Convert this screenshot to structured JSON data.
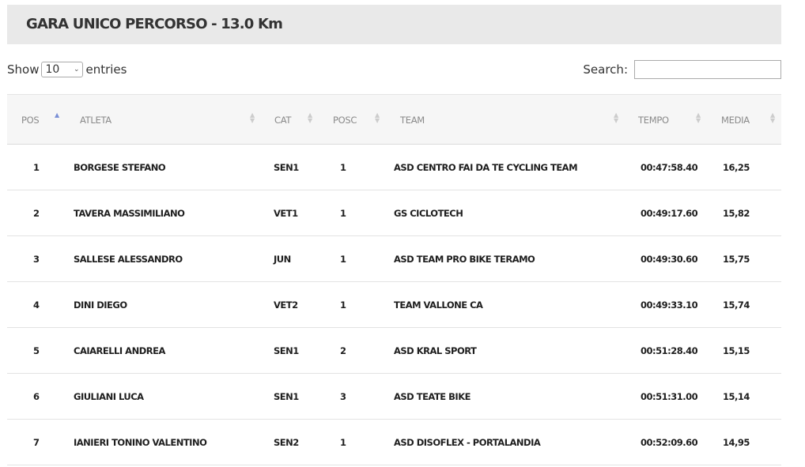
{
  "page": {
    "title": "GARA UNICO PERCORSO - 13.0 Km"
  },
  "controls": {
    "show_label": "Show",
    "entries_value": "10",
    "entries_label": "entries",
    "search_label": "Search:",
    "search_value": ""
  },
  "table": {
    "headers": [
      "POS",
      "ATLETA",
      "CAT",
      "POSC",
      "TEAM",
      "TEMPO",
      "MEDIA"
    ],
    "sorted_column": "POS",
    "sort_direction": "ascending",
    "rows": [
      [
        "1",
        "BORGESE STEFANO",
        "SEN1",
        "1",
        "ASD CENTRO FAI DA TE CYCLING TEAM",
        "00:47:58.40",
        "16,25"
      ],
      [
        "2",
        "TAVERA MASSIMILIANO",
        "VET1",
        "1",
        "GS CICLOTECH",
        "00:49:17.60",
        "15,82"
      ],
      [
        "3",
        "SALLESE ALESSANDRO",
        "JUN",
        "1",
        "ASD TEAM PRO BIKE TERAMO",
        "00:49:30.60",
        "15,75"
      ],
      [
        "4",
        "DINI DIEGO",
        "VET2",
        "1",
        "TEAM VALLONE CA",
        "00:49:33.10",
        "15,74"
      ],
      [
        "5",
        "CAIARELLI ANDREA",
        "SEN1",
        "2",
        "ASD KRAL SPORT",
        "00:51:28.40",
        "15,15"
      ],
      [
        "6",
        "GIULIANI LUCA",
        "SEN1",
        "3",
        "ASD TEATE BIKE",
        "00:51:31.00",
        "15,14"
      ],
      [
        "7",
        "IANIERI TONINO VALENTINO",
        "SEN2",
        "1",
        "ASD DISOFLEX - PORTALANDIA",
        "00:52:09.60",
        "14,95"
      ]
    ]
  },
  "icons": {
    "sort_icon": "up-down-triangles",
    "dropdown_icon": "chevron-down"
  },
  "colors": {
    "header_bg": "#e9e9e9",
    "sort_active": "#7a8fd6"
  }
}
